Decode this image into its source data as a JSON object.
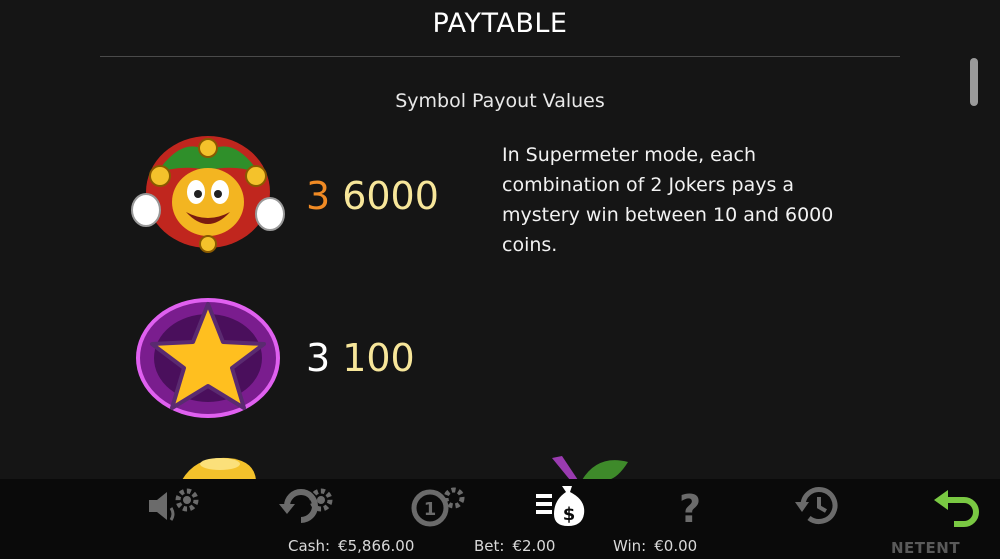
{
  "header": {
    "title": "PAYTABLE"
  },
  "section": {
    "subtitle": "Symbol Payout Values"
  },
  "symbols": [
    {
      "name": "joker",
      "count": "3",
      "amount": "6000",
      "count_color": "#f08a24",
      "description": "In Supermeter mode, each combination of 2 Jokers pays a mystery win between 10 and 6000 coins."
    },
    {
      "name": "star",
      "count": "3",
      "amount": "100",
      "count_color": "#ffffff"
    }
  ],
  "toolbar": {
    "icons": [
      "sound-settings-icon",
      "autoplay-settings-icon",
      "coin-settings-icon",
      "paytable-icon",
      "help-icon",
      "history-icon",
      "back-icon"
    ],
    "active_color": "#ffffff",
    "inactive_color": "#6b6b6b",
    "back_color": "#7ac943"
  },
  "status": {
    "cash_label": "Cash:",
    "cash_value": "€5,866.00",
    "bet_label": "Bet:",
    "bet_value": "€2.00",
    "win_label": "Win:",
    "win_value": "€0.00"
  },
  "brand": "NETENT"
}
